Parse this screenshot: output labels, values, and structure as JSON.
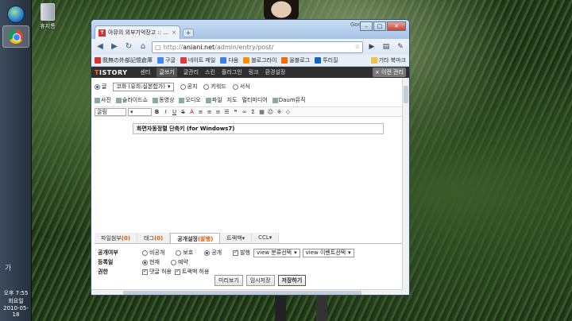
{
  "desktop": {
    "recycle_label": "휴지통"
  },
  "tray": {
    "ime": "가",
    "time": "오후 7:55",
    "day": "화요일",
    "date": "2010-05-18"
  },
  "browser": {
    "tab_title": "아뮤의 외부기억장고 :: ...",
    "tab_close": "×",
    "new_tab": "+",
    "search_engine_label": "Google",
    "url_prefix": "http://",
    "url_host": "aniani.net",
    "url_path": "/admin/entry/post/",
    "window_controls": {
      "minimize": "–",
      "maximize": "□",
      "close": "✕"
    }
  },
  "bookmarks": [
    {
      "label": "我無の外部記憶倉庫",
      "color": "#d8322a"
    },
    {
      "label": "구글",
      "color": "#4285f4"
    },
    {
      "label": "네이트 메일",
      "color": "#e53935"
    },
    {
      "label": "다음",
      "color": "#3f7ee8"
    },
    {
      "label": "블로그라이",
      "color": "#ff8f00"
    },
    {
      "label": "올블로그",
      "color": "#ef6c00"
    },
    {
      "label": "투리질",
      "color": "#1565c0"
    },
    {
      "label": "기타 북마크",
      "color": "#f2c04b"
    }
  ],
  "tistory_nav": {
    "logo_t": "T",
    "logo_rest": "ISTORY",
    "items": [
      "센터",
      "글쓰기",
      "글관리",
      "스킨",
      "플러그인",
      "링크",
      "환경설정"
    ],
    "active_index": 1,
    "old_admin": "× 이전 관리"
  },
  "editor": {
    "types": [
      {
        "label": "글",
        "selected": true
      },
      {
        "label": "공지",
        "selected": false
      },
      {
        "label": "키워드",
        "selected": false
      },
      {
        "label": "서식",
        "selected": false
      }
    ],
    "category": "코화 (유희:실본합가)",
    "attachments": [
      "사진",
      "슬라이드쇼",
      "동영상",
      "오디오",
      "파일",
      "지도",
      "멀티미디어",
      "Daum뮤직"
    ],
    "font_select": "굴림",
    "title_value": "화면자동정렬 단축키 (for Windows7)"
  },
  "meta_tabs": [
    {
      "label": "파일첨부",
      "count": "(0)"
    },
    {
      "label": "태그",
      "count": "(0)"
    },
    {
      "label": "공개설정",
      "count": "(발행)"
    },
    {
      "label": "트랙백",
      "count": "▾"
    },
    {
      "label": "CCL",
      "count": "▾"
    }
  ],
  "meta": {
    "visibility_label": "공개여부",
    "visibility_options": [
      "비공개",
      "보호",
      "공개",
      "발행"
    ],
    "view_category": "view 분류선택",
    "view_event": "view 이벤트선택",
    "register_label": "등록일",
    "register_options": [
      "현재",
      "예약"
    ],
    "permission_label": "권한",
    "permission_options": [
      "댓글 허용",
      "트랙백 허용"
    ]
  },
  "actions": {
    "preview": "미리보기",
    "temp_save": "임시저장",
    "save": "저장하기"
  }
}
